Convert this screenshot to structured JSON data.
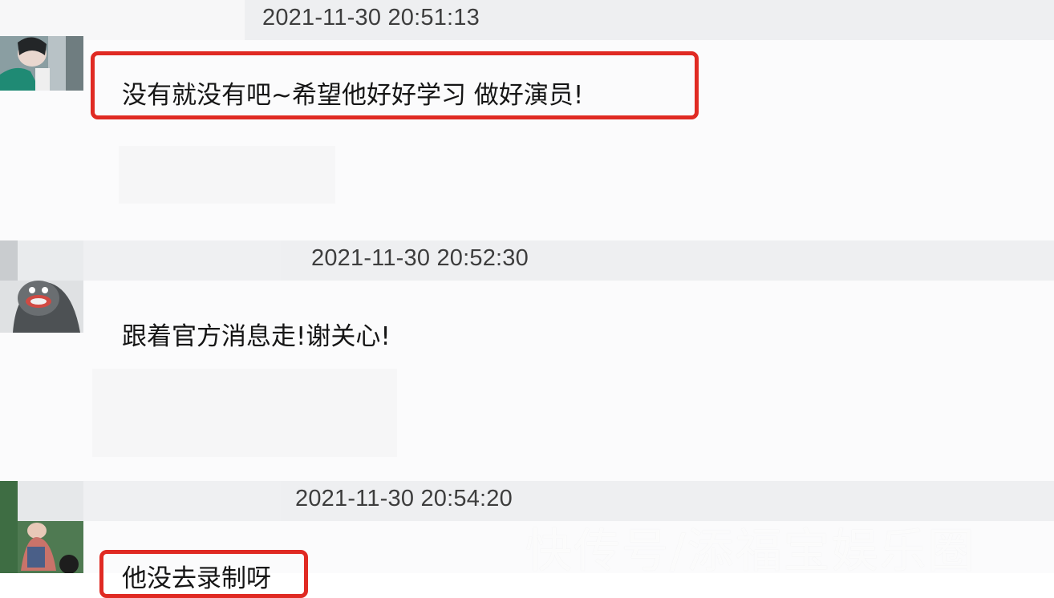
{
  "messages": [
    {
      "timestamp": "2021-11-30 20:51:13",
      "text": "没有就没有吧~希望他好好学习 做好演员!",
      "highlighted": true
    },
    {
      "timestamp": "2021-11-30 20:52:30",
      "text": "跟着官方消息走!谢关心!",
      "highlighted": false
    },
    {
      "timestamp": "2021-11-30 20:54:20",
      "text": "他没去录制呀",
      "highlighted": true
    }
  ],
  "watermark": "快传号/添福宝娱乐圈",
  "colors": {
    "highlight_border": "#e02a23",
    "timestamp_bar": "#eeeff1",
    "message_bg": "#fbfbfc"
  },
  "icons": [
    "user-avatar-1",
    "user-avatar-2",
    "user-avatar-3"
  ]
}
